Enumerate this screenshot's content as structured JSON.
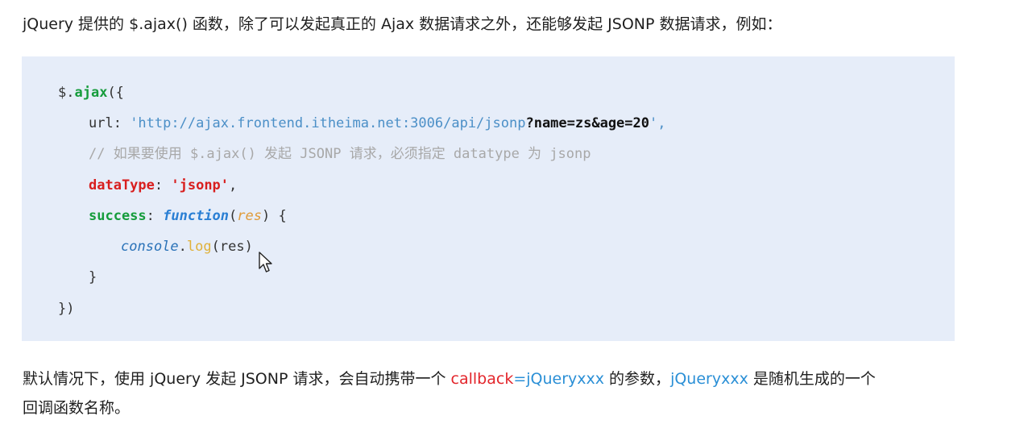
{
  "intro_text": "jQuery 提供的 $.ajax() 函数，除了可以发起真正的 Ajax 数据请求之外，还能够发起 JSONP 数据请求，例如：",
  "code": {
    "line1": {
      "prefix": "$.",
      "method": "ajax",
      "suffix": "({"
    },
    "line2": {
      "key": "url: ",
      "url": "'http://ajax.frontend.itheima.net:3006/api/jsonp",
      "query": "?name=zs&age=20",
      "end": "',"
    },
    "line3": {
      "comment": "// 如果要使用 $.ajax() 发起 JSONP 请求，必须指定 datatype 为 jsonp"
    },
    "line4": {
      "key": "dataType",
      "colon": ": ",
      "value": "'jsonp'",
      "end": ","
    },
    "line5": {
      "key": "success",
      "colon": ": ",
      "fn": "function",
      "open": "(",
      "param": "res",
      "close": ") {"
    },
    "line6": {
      "obj": "console",
      "dot": ".",
      "call": "log",
      "args": "(res)"
    },
    "line7": {
      "text": "}"
    },
    "line8": {
      "text": "})"
    }
  },
  "paragraph": {
    "part1": "默认情况下，使用 jQuery 发起 JSONP 请求，会自动携带一个 ",
    "callback": "callback",
    "equals": "=",
    "jq1": "jQueryxxx",
    "part2": " 的参数，",
    "jq2": "jQueryxxx",
    "part3": " 是随机生成的一个",
    "part4": "回调函数名称。"
  },
  "colors": {
    "code_background": "#e6edf9",
    "highlight_red": "#e3252b",
    "highlight_blue": "#2a8fd6"
  },
  "icons": {
    "cursor": "mouse-pointer-icon"
  }
}
